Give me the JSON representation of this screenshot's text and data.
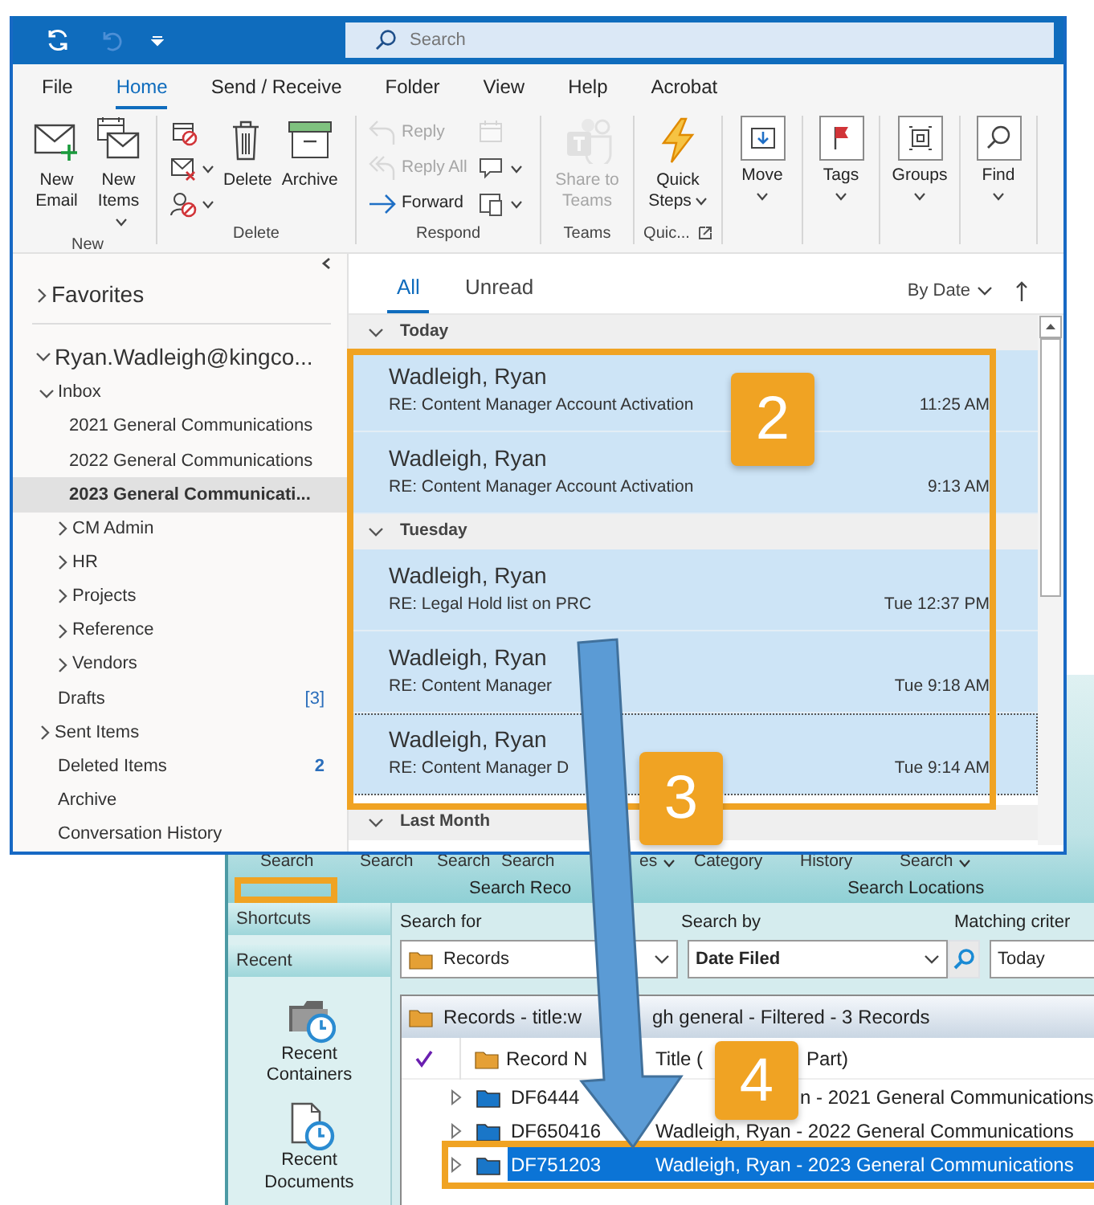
{
  "outlook": {
    "search": {
      "placeholder": "Search"
    },
    "menu_tabs": [
      {
        "label": "File",
        "selected": false
      },
      {
        "label": "Home",
        "selected": true
      },
      {
        "label": "Send / Receive",
        "selected": false
      },
      {
        "label": "Folder",
        "selected": false
      },
      {
        "label": "View",
        "selected": false
      },
      {
        "label": "Help",
        "selected": false
      },
      {
        "label": "Acrobat",
        "selected": false
      }
    ],
    "ribbon_groups": [
      {
        "label": "New",
        "buttons": [
          {
            "kind": "large",
            "label": "New Email",
            "disabled": false,
            "dropdown": false
          },
          {
            "kind": "large",
            "label": "New Items",
            "disabled": false,
            "dropdown": true
          }
        ]
      },
      {
        "label": "Delete",
        "buttons": [
          {
            "kind": "small",
            "disabled": false,
            "dropdown": false
          },
          {
            "kind": "small",
            "disabled": false,
            "dropdown": true
          },
          {
            "kind": "small",
            "disabled": false,
            "dropdown": true
          },
          {
            "kind": "large",
            "label": "Delete",
            "disabled": false,
            "dropdown": false
          },
          {
            "kind": "large",
            "label": "Archive",
            "disabled": false,
            "dropdown": false
          }
        ]
      },
      {
        "label": "Respond",
        "buttons": [
          {
            "kind": "small",
            "label": "Reply",
            "disabled": true,
            "dropdown": false
          },
          {
            "kind": "small",
            "label": "Reply All",
            "disabled": true,
            "dropdown": false
          },
          {
            "kind": "small",
            "label": "Forward",
            "disabled": false,
            "dropdown": false
          },
          {
            "kind": "small",
            "disabled": true,
            "dropdown": false
          },
          {
            "kind": "small",
            "disabled": false,
            "dropdown": true
          },
          {
            "kind": "small",
            "disabled": false,
            "dropdown": true
          }
        ]
      },
      {
        "label": "Teams",
        "buttons": [
          {
            "kind": "large",
            "label": "Share to Teams",
            "disabled": true,
            "dropdown": false
          }
        ]
      },
      {
        "label": "Quic...",
        "launcher": true,
        "buttons": [
          {
            "kind": "large",
            "label": "Quick Steps",
            "disabled": false,
            "dropdown": true
          }
        ]
      },
      {
        "buttons": [
          {
            "kind": "boxed",
            "label": "Move",
            "disabled": false,
            "dropdown": true
          }
        ]
      },
      {
        "buttons": [
          {
            "kind": "boxed",
            "label": "Tags",
            "disabled": false,
            "dropdown": true
          }
        ]
      },
      {
        "buttons": [
          {
            "kind": "boxed",
            "label": "Groups",
            "disabled": false,
            "dropdown": true
          }
        ]
      },
      {
        "buttons": [
          {
            "kind": "boxed",
            "label": "Find",
            "disabled": false,
            "dropdown": true
          }
        ]
      }
    ],
    "folders": [
      {
        "label": "Favorites",
        "expanded": false,
        "selected": false
      },
      {
        "label": "Ryan.Wadleigh@kingco...",
        "expanded": true,
        "selected": false,
        "children": [
          {
            "label": "Inbox",
            "expanded": true,
            "selected": false,
            "children": [
              {
                "label": "2021 General Communications",
                "selected": false
              },
              {
                "label": "2022 General Communications",
                "selected": false
              },
              {
                "label": "2023 General Communicati...",
                "selected": true
              },
              {
                "label": "CM Admin",
                "expanded": false,
                "selected": false
              },
              {
                "label": "HR",
                "expanded": false,
                "selected": false
              },
              {
                "label": "Projects",
                "expanded": false,
                "selected": false
              },
              {
                "label": "Reference",
                "expanded": false,
                "selected": false
              },
              {
                "label": "Vendors",
                "expanded": false,
                "selected": false
              }
            ]
          },
          {
            "label": "Drafts",
            "count": "[3]",
            "selected": false
          },
          {
            "label": "Sent Items",
            "expanded": false,
            "selected": false
          },
          {
            "label": "Deleted Items",
            "count": "2",
            "unread": true,
            "selected": false
          },
          {
            "label": "Archive",
            "selected": false
          },
          {
            "label": "Conversation History",
            "selected": false
          }
        ]
      }
    ],
    "list_tabs": [
      {
        "label": "All",
        "selected": true
      },
      {
        "label": "Unread",
        "selected": false
      }
    ],
    "sort": "By Date",
    "message_groups": [
      {
        "label": "Today",
        "expanded": true,
        "messages": [
          {
            "sender": "Wadleigh, Ryan",
            "subject": "RE: Content Manager Account Activation",
            "time": "11:25 AM",
            "selected": true,
            "focused": false
          },
          {
            "sender": "Wadleigh, Ryan",
            "subject": "RE: Content Manager Account Activation",
            "time": "9:13 AM",
            "selected": true,
            "focused": false
          }
        ]
      },
      {
        "label": "Tuesday",
        "expanded": true,
        "messages": [
          {
            "sender": "Wadleigh, Ryan",
            "subject": "RE: Legal Hold list on PRC",
            "time": "Tue 12:37 PM",
            "selected": true,
            "focused": false
          },
          {
            "sender": "Wadleigh, Ryan",
            "subject": "RE: Content Manager",
            "time": "Tue 9:18 AM",
            "selected": true,
            "focused": false
          },
          {
            "sender": "Wadleigh, Ryan",
            "subject": "RE: Content Manager D",
            "time": "Tue 9:14 AM",
            "selected": true,
            "focused": true
          }
        ]
      },
      {
        "label": "Last Month",
        "expanded": true
      }
    ]
  },
  "content_manager": {
    "ribbon_labels": [
      "Search",
      "Search",
      "Search",
      "Search",
      "es",
      "Category",
      "History",
      "Search"
    ],
    "ribbon_groups": [
      "Search Reco",
      "Search Locations"
    ],
    "sidebar": {
      "headers": [
        "Shortcuts",
        "Recent"
      ],
      "items": [
        "Recent Containers",
        "Recent Documents"
      ]
    },
    "search": {
      "labels": [
        "Search for",
        "Search by",
        "Matching criter"
      ],
      "search_for": "Records",
      "search_by": "Date Filed",
      "criteria": "Today"
    },
    "results": {
      "title_parts": [
        "Records - title:w",
        "gh general - Filtered - 3 Records"
      ],
      "columns": [
        "Record N",
        "Title (",
        "Part)"
      ],
      "rows": [
        {
          "number": "DF6444",
          "title": "n - 2021 General Communications",
          "selected": false
        },
        {
          "number": "DF650416",
          "title": "Wadleigh, Ryan - 2022 General Communications",
          "selected": false
        },
        {
          "number": "DF751203",
          "title": "Wadleigh, Ryan - 2023 General Communications",
          "selected": true
        }
      ]
    }
  },
  "callouts": [
    {
      "label": "2"
    },
    {
      "label": "3"
    },
    {
      "label": "4"
    }
  ]
}
